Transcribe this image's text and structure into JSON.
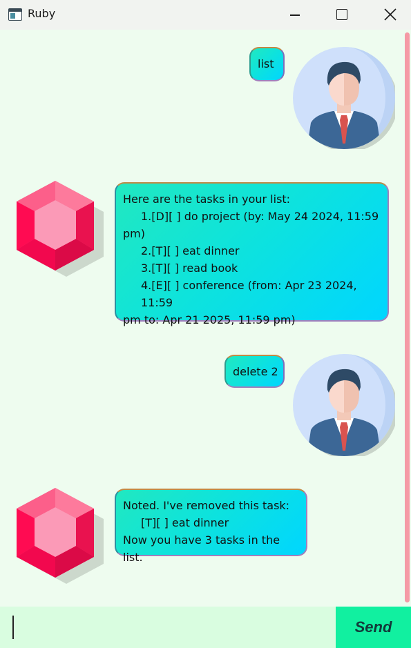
{
  "window": {
    "title": "Ruby"
  },
  "colors": {
    "background": "#eefcef",
    "input_bg": "#d9fde0",
    "send_button": "#11f0a0",
    "scroll_thumb": "#f59aa5",
    "bubble_start": "#21e8c0",
    "bubble_end": "#00d6ff"
  },
  "messages": [
    {
      "sender": "user",
      "avatar": "businessman-avatar-icon",
      "lines": [
        "list"
      ]
    },
    {
      "sender": "bot",
      "avatar": "ruby-gem-icon",
      "lines": [
        "Here are the tasks in your list:",
        "1.[D][ ] do project (by: May 24 2024, 11:59",
        "pm)",
        "2.[T][ ] eat dinner",
        "3.[T][ ] read book",
        "4.[E][ ] conference (from: Apr 23 2024, 11:59",
        "pm to: Apr 21 2025, 11:59 pm)"
      ]
    },
    {
      "sender": "user",
      "avatar": "businessman-avatar-icon",
      "lines": [
        "delete 2"
      ]
    },
    {
      "sender": "bot",
      "avatar": "ruby-gem-icon",
      "lines": [
        "Noted. I've removed this task:",
        "[T][ ] eat dinner",
        "Now you have 3 tasks in the list."
      ]
    }
  ],
  "input": {
    "value": "",
    "placeholder": ""
  },
  "send_label": "Send"
}
